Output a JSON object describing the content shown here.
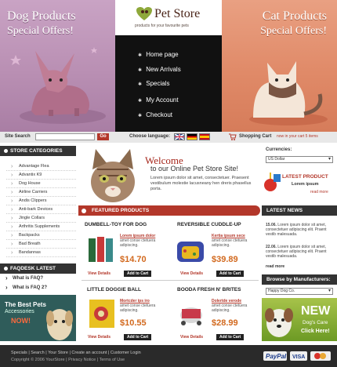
{
  "header": {
    "dog_title": "Dog Products",
    "dog_sub": "Special Offers!",
    "cat_title": "Cat Products",
    "cat_sub": "Special Offers!",
    "logo": "Pet Store",
    "logo_sub": "products for your favourite pets",
    "nav": [
      "Home page",
      "New Arrivals",
      "Specials",
      "My Account",
      "Checkout"
    ]
  },
  "search": {
    "label": "Site Search",
    "go": "Go",
    "placeholder": ""
  },
  "language": {
    "label": "Choose language:"
  },
  "cart": {
    "label": "Shopping Cart",
    "now": "now in your cart 5 items"
  },
  "categories": {
    "title": "STORE CATEGORIES",
    "items": [
      "Advantage Flea",
      "Advantix K9",
      "Dog House",
      "Airline Carriers",
      "Andis Clippers",
      "Anti-bark Devices",
      "Jingle Collars",
      "Arthritis Supplements",
      "Backpacks",
      "Bad Breath",
      "Bandannas"
    ]
  },
  "faq": {
    "title": "FAQDESK LATEST",
    "items": [
      "What is FAQ?",
      "What is FAQ 2?"
    ]
  },
  "pets_banner": {
    "line1": "The Best Pets",
    "line2": "Accessories",
    "line3": "NOW!"
  },
  "welcome": {
    "title": "Welcome",
    "sub": "to our Online Pet Store Site!",
    "text": "Lorem ipsum dolor sit amet, consectetuer. Praesent vestibulum molestie lacusneany hen dreris phasellus porta."
  },
  "featured": {
    "title": "FEATURED PRODUCTS",
    "products": [
      {
        "name": "DUMBELL-TOY FOR DOG",
        "desc_link": "Lorem ipsum dolor",
        "desc": "amet conse ctetuera adipiscing.",
        "price": "$14.70",
        "view": "View Details",
        "add": "Add to Cart"
      },
      {
        "name": "REVERSIBLE CUDDLE-UP",
        "desc_link": "Kertia ipsum sece",
        "desc": "amet conse ctetuera adipiscing.",
        "price": "$39.89",
        "view": "View Details",
        "add": "Add to Cart"
      },
      {
        "name": "LITTLE DOGGIE BALL",
        "desc_link": "Mortcder ips iro",
        "desc": "amet conse ctetuera adipiscing.",
        "price": "$10.55",
        "view": "View Details",
        "add": "Add to Cart"
      },
      {
        "name": "BOODA FRESH N' BRITES",
        "desc_link": "Dolertde verode",
        "desc": "amet conse ctetuera adipiscing.",
        "price": "$28.99",
        "view": "View Details",
        "add": "Add to Cart"
      }
    ]
  },
  "currencies": {
    "title": "Currencies:",
    "selected": "US Dollar"
  },
  "latest_product": {
    "title": "LATEST PRODUCT",
    "name": "Lorem ipsum",
    "link": "read more"
  },
  "news": {
    "title": "LATEST NEWS",
    "items": [
      {
        "date": "15.06.",
        "text": "Lorem ipsum dolor sit amet, consectetuer adipiscing elit. Praent vestib malesuada."
      },
      {
        "date": "22.06.",
        "text": "Lorem ipsum dolor sit amet, consectetuer adipiscing elit. Praent vestib malesuada."
      }
    ],
    "more": "read more"
  },
  "manufacturers": {
    "title": "Browse by Manufacturers:",
    "selected": "Happy Dog Co."
  },
  "new_banner": {
    "line1": "NEW",
    "line2": "Dog's Care",
    "line3": "Click Here!"
  },
  "footer": {
    "links": [
      "Specials",
      "Search",
      "Your Store",
      "Create an account",
      "Customer Login",
      "Privacy Notice",
      "Terms of Use"
    ],
    "copyright": "Copyright © 2006 YourStore"
  },
  "colors": {
    "accent": "#b3372a",
    "dark": "#333333",
    "price": "#d2691e"
  }
}
